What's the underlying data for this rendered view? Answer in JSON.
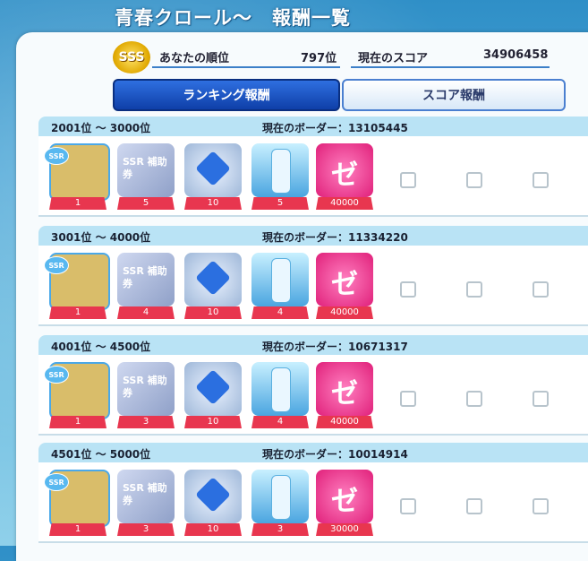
{
  "header": {
    "title": "青春クロール～　報酬一覧"
  },
  "player": {
    "rank_label": "あなたの順位",
    "rank_value": "797位",
    "score_label": "現在のスコア",
    "score_value": "34906458",
    "badge": "SSS"
  },
  "tabs": [
    {
      "label": "ランキング報酬",
      "active": true
    },
    {
      "label": "スコア報酬",
      "active": false
    }
  ],
  "tiers": [
    {
      "range": "2001位 ～ 3000位",
      "border": "現在のボーダー：13105445",
      "quantities": [
        "1",
        "5",
        "10",
        "5",
        "40000"
      ]
    },
    {
      "range": "3001位 ～ 4000位",
      "border": "現在のボーダー：11334220",
      "quantities": [
        "1",
        "4",
        "10",
        "4",
        "40000"
      ]
    },
    {
      "range": "4001位 ～ 4500位",
      "border": "現在のボーダー：10671317",
      "quantities": [
        "1",
        "3",
        "10",
        "4",
        "40000"
      ]
    },
    {
      "range": "4501位 ～ 5000位",
      "border": "現在のボーダー：10014914",
      "quantities": [
        "1",
        "3",
        "10",
        "3",
        "30000"
      ]
    }
  ],
  "item_labels": {
    "ssr": "SSR",
    "ticket": "SSR 補助券",
    "coin": "ゼ"
  },
  "colors": {
    "accent": "#0f3fa8",
    "qty_bg": "#e8364f",
    "header_bg": "#b9e3f5"
  }
}
